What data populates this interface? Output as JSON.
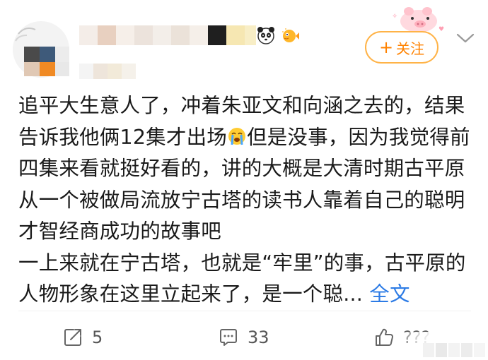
{
  "header": {
    "follow_label": "关注",
    "follow_plus": "+"
  },
  "post": {
    "text": "追平大生意人了，冲着朱亚文和向涵之去的，结果告诉我他俩12集才出场",
    "text_after_emoji": "但是没事，因为我觉得前四集来看就挺好看的，讲的大概是大清时期古平原从一个被做局流放宁古塔的读书人靠着自己的聪明才智经商成功的故事吧\n一上来就在宁古塔，也就是“牢里”的事，古平原的人物形象在这里立起来了，是一个聪...",
    "full_text_link": "全文"
  },
  "footer": {
    "repost_count": "5",
    "comment_count": "33",
    "like_count": "???"
  },
  "colors": {
    "accent": "#ff8200",
    "link": "#2c7be5",
    "text": "#1a1a1a",
    "meta": "#555555"
  }
}
